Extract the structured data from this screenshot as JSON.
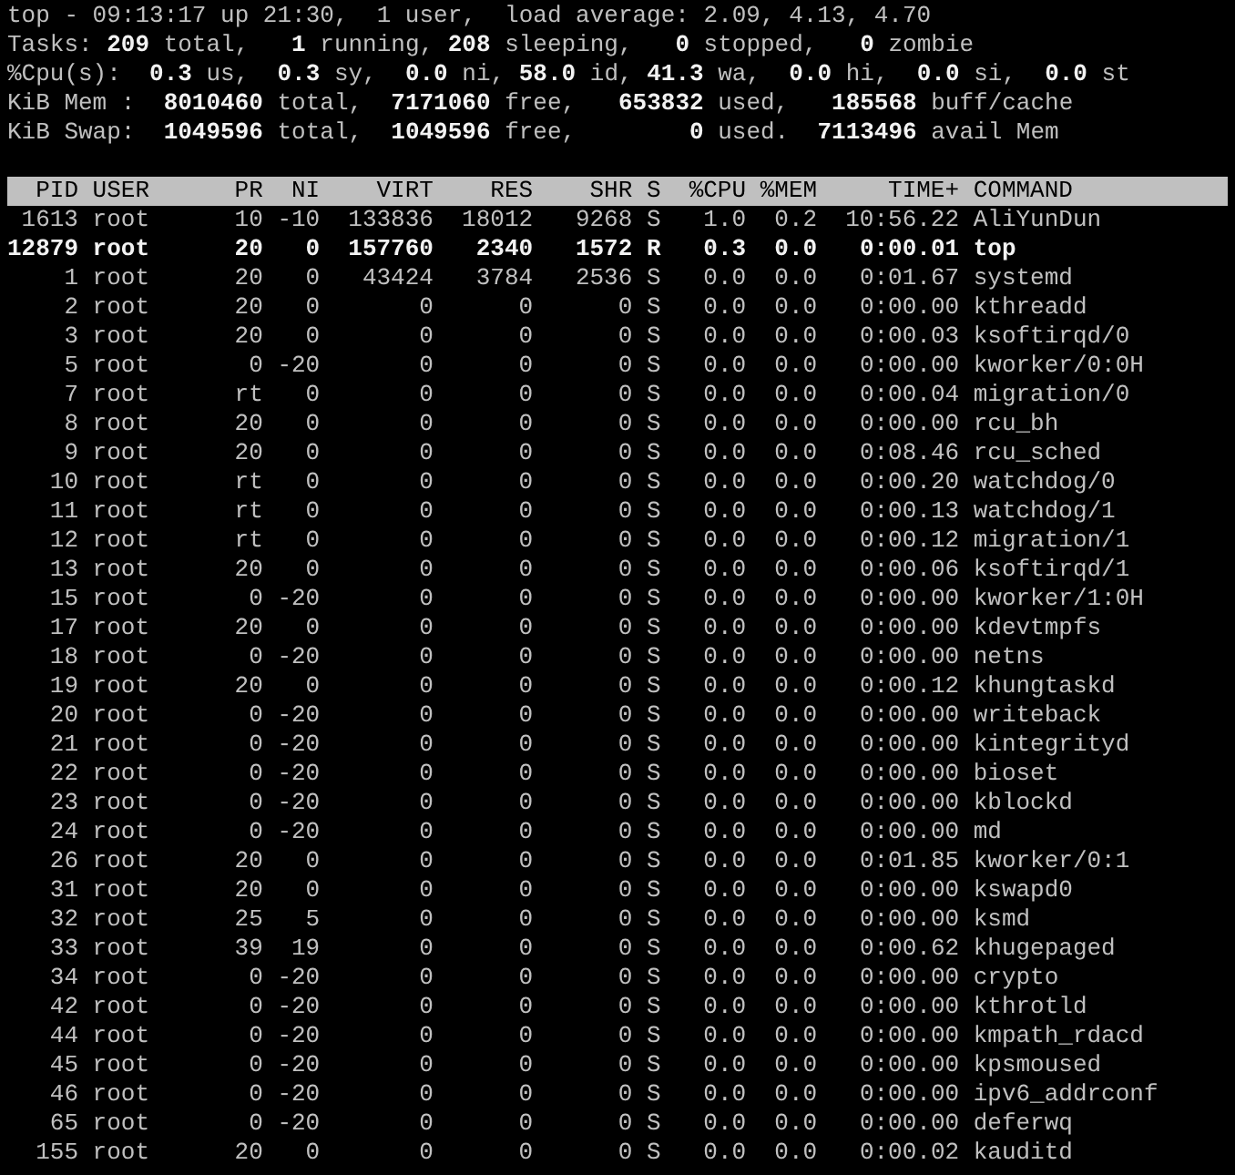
{
  "summary": [
    "top - 09:13:17 up 21:30,  1 user,  load average: 2.09, 4.13, 4.70",
    "Tasks: **209** total,   **1** running, **208** sleeping,   **0** stopped,   **0** zombie",
    "%Cpu(s):  **0.3** us,  **0.3** sy,  **0.0** ni, **58.0** id, **41.3** wa,  **0.0** hi,  **0.0** si,  **0.0** st",
    "KiB Mem :  **8010460** total,  **7171060** free,   **653832** used,   **185568** buff/cache",
    "KiB Swap:  **1049596** total,  **1049596** free,        **0** used.  **7113496** avail Mem"
  ],
  "table": {
    "columns": [
      "PID",
      "USER",
      "PR",
      "NI",
      "VIRT",
      "RES",
      "SHR",
      "S",
      "%CPU",
      "%MEM",
      "TIME+",
      "COMMAND"
    ],
    "rows": [
      {
        "highlighted": false,
        "cells": [
          "1613",
          "root",
          "10",
          "-10",
          "133836",
          "18012",
          "9268",
          "S",
          "1.0",
          "0.2",
          "10:56.22",
          "AliYunDun"
        ]
      },
      {
        "highlighted": true,
        "cells": [
          "12879",
          "root",
          "20",
          "0",
          "157760",
          "2340",
          "1572",
          "R",
          "0.3",
          "0.0",
          "0:00.01",
          "top"
        ]
      },
      {
        "highlighted": false,
        "cells": [
          "1",
          "root",
          "20",
          "0",
          "43424",
          "3784",
          "2536",
          "S",
          "0.0",
          "0.0",
          "0:01.67",
          "systemd"
        ]
      },
      {
        "highlighted": false,
        "cells": [
          "2",
          "root",
          "20",
          "0",
          "0",
          "0",
          "0",
          "S",
          "0.0",
          "0.0",
          "0:00.00",
          "kthreadd"
        ]
      },
      {
        "highlighted": false,
        "cells": [
          "3",
          "root",
          "20",
          "0",
          "0",
          "0",
          "0",
          "S",
          "0.0",
          "0.0",
          "0:00.03",
          "ksoftirqd/0"
        ]
      },
      {
        "highlighted": false,
        "cells": [
          "5",
          "root",
          "0",
          "-20",
          "0",
          "0",
          "0",
          "S",
          "0.0",
          "0.0",
          "0:00.00",
          "kworker/0:0H"
        ]
      },
      {
        "highlighted": false,
        "cells": [
          "7",
          "root",
          "rt",
          "0",
          "0",
          "0",
          "0",
          "S",
          "0.0",
          "0.0",
          "0:00.04",
          "migration/0"
        ]
      },
      {
        "highlighted": false,
        "cells": [
          "8",
          "root",
          "20",
          "0",
          "0",
          "0",
          "0",
          "S",
          "0.0",
          "0.0",
          "0:00.00",
          "rcu_bh"
        ]
      },
      {
        "highlighted": false,
        "cells": [
          "9",
          "root",
          "20",
          "0",
          "0",
          "0",
          "0",
          "S",
          "0.0",
          "0.0",
          "0:08.46",
          "rcu_sched"
        ]
      },
      {
        "highlighted": false,
        "cells": [
          "10",
          "root",
          "rt",
          "0",
          "0",
          "0",
          "0",
          "S",
          "0.0",
          "0.0",
          "0:00.20",
          "watchdog/0"
        ]
      },
      {
        "highlighted": false,
        "cells": [
          "11",
          "root",
          "rt",
          "0",
          "0",
          "0",
          "0",
          "S",
          "0.0",
          "0.0",
          "0:00.13",
          "watchdog/1"
        ]
      },
      {
        "highlighted": false,
        "cells": [
          "12",
          "root",
          "rt",
          "0",
          "0",
          "0",
          "0",
          "S",
          "0.0",
          "0.0",
          "0:00.12",
          "migration/1"
        ]
      },
      {
        "highlighted": false,
        "cells": [
          "13",
          "root",
          "20",
          "0",
          "0",
          "0",
          "0",
          "S",
          "0.0",
          "0.0",
          "0:00.06",
          "ksoftirqd/1"
        ]
      },
      {
        "highlighted": false,
        "cells": [
          "15",
          "root",
          "0",
          "-20",
          "0",
          "0",
          "0",
          "S",
          "0.0",
          "0.0",
          "0:00.00",
          "kworker/1:0H"
        ]
      },
      {
        "highlighted": false,
        "cells": [
          "17",
          "root",
          "20",
          "0",
          "0",
          "0",
          "0",
          "S",
          "0.0",
          "0.0",
          "0:00.00",
          "kdevtmpfs"
        ]
      },
      {
        "highlighted": false,
        "cells": [
          "18",
          "root",
          "0",
          "-20",
          "0",
          "0",
          "0",
          "S",
          "0.0",
          "0.0",
          "0:00.00",
          "netns"
        ]
      },
      {
        "highlighted": false,
        "cells": [
          "19",
          "root",
          "20",
          "0",
          "0",
          "0",
          "0",
          "S",
          "0.0",
          "0.0",
          "0:00.12",
          "khungtaskd"
        ]
      },
      {
        "highlighted": false,
        "cells": [
          "20",
          "root",
          "0",
          "-20",
          "0",
          "0",
          "0",
          "S",
          "0.0",
          "0.0",
          "0:00.00",
          "writeback"
        ]
      },
      {
        "highlighted": false,
        "cells": [
          "21",
          "root",
          "0",
          "-20",
          "0",
          "0",
          "0",
          "S",
          "0.0",
          "0.0",
          "0:00.00",
          "kintegrityd"
        ]
      },
      {
        "highlighted": false,
        "cells": [
          "22",
          "root",
          "0",
          "-20",
          "0",
          "0",
          "0",
          "S",
          "0.0",
          "0.0",
          "0:00.00",
          "bioset"
        ]
      },
      {
        "highlighted": false,
        "cells": [
          "23",
          "root",
          "0",
          "-20",
          "0",
          "0",
          "0",
          "S",
          "0.0",
          "0.0",
          "0:00.00",
          "kblockd"
        ]
      },
      {
        "highlighted": false,
        "cells": [
          "24",
          "root",
          "0",
          "-20",
          "0",
          "0",
          "0",
          "S",
          "0.0",
          "0.0",
          "0:00.00",
          "md"
        ]
      },
      {
        "highlighted": false,
        "cells": [
          "26",
          "root",
          "20",
          "0",
          "0",
          "0",
          "0",
          "S",
          "0.0",
          "0.0",
          "0:01.85",
          "kworker/0:1"
        ]
      },
      {
        "highlighted": false,
        "cells": [
          "31",
          "root",
          "20",
          "0",
          "0",
          "0",
          "0",
          "S",
          "0.0",
          "0.0",
          "0:00.00",
          "kswapd0"
        ]
      },
      {
        "highlighted": false,
        "cells": [
          "32",
          "root",
          "25",
          "5",
          "0",
          "0",
          "0",
          "S",
          "0.0",
          "0.0",
          "0:00.00",
          "ksmd"
        ]
      },
      {
        "highlighted": false,
        "cells": [
          "33",
          "root",
          "39",
          "19",
          "0",
          "0",
          "0",
          "S",
          "0.0",
          "0.0",
          "0:00.62",
          "khugepaged"
        ]
      },
      {
        "highlighted": false,
        "cells": [
          "34",
          "root",
          "0",
          "-20",
          "0",
          "0",
          "0",
          "S",
          "0.0",
          "0.0",
          "0:00.00",
          "crypto"
        ]
      },
      {
        "highlighted": false,
        "cells": [
          "42",
          "root",
          "0",
          "-20",
          "0",
          "0",
          "0",
          "S",
          "0.0",
          "0.0",
          "0:00.00",
          "kthrotld"
        ]
      },
      {
        "highlighted": false,
        "cells": [
          "44",
          "root",
          "0",
          "-20",
          "0",
          "0",
          "0",
          "S",
          "0.0",
          "0.0",
          "0:00.00",
          "kmpath_rdacd"
        ]
      },
      {
        "highlighted": false,
        "cells": [
          "45",
          "root",
          "0",
          "-20",
          "0",
          "0",
          "0",
          "S",
          "0.0",
          "0.0",
          "0:00.00",
          "kpsmoused"
        ]
      },
      {
        "highlighted": false,
        "cells": [
          "46",
          "root",
          "0",
          "-20",
          "0",
          "0",
          "0",
          "S",
          "0.0",
          "0.0",
          "0:00.00",
          "ipv6_addrconf"
        ]
      },
      {
        "highlighted": false,
        "cells": [
          "65",
          "root",
          "0",
          "-20",
          "0",
          "0",
          "0",
          "S",
          "0.0",
          "0.0",
          "0:00.00",
          "deferwq"
        ]
      },
      {
        "highlighted": false,
        "cells": [
          "155",
          "root",
          "20",
          "0",
          "0",
          "0",
          "0",
          "S",
          "0.0",
          "0.0",
          "0:00.02",
          "kauditd"
        ]
      }
    ]
  }
}
